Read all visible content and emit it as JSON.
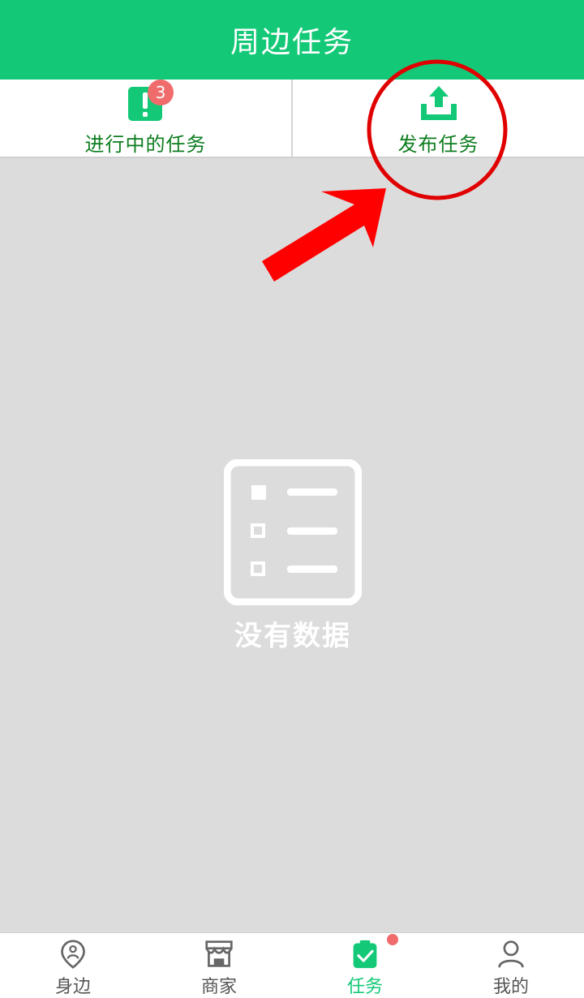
{
  "header": {
    "title": "周边任务"
  },
  "tabs": [
    {
      "label": "进行中的任务",
      "icon": "alert-icon",
      "badge": "3"
    },
    {
      "label": "发布任务",
      "icon": "upload-icon"
    }
  ],
  "empty_state": {
    "icon": "list-icon",
    "text": "没有数据"
  },
  "bottom_nav": {
    "items": [
      {
        "label": "身边",
        "icon": "location-person-icon",
        "active": false
      },
      {
        "label": "商家",
        "icon": "shop-icon",
        "active": false
      },
      {
        "label": "任务",
        "icon": "clipboard-check-icon",
        "active": true,
        "has_dot": true
      },
      {
        "label": "我的",
        "icon": "person-icon",
        "active": false
      }
    ]
  },
  "colors": {
    "brand_green": "#13c977",
    "tab_label_green": "#0d7d1f",
    "badge_red": "#f06c6c",
    "content_bg": "#dcdcdc",
    "annotation_red": "#e00000"
  }
}
